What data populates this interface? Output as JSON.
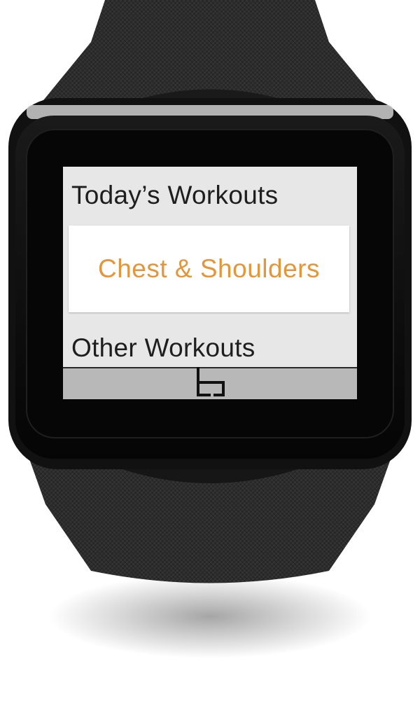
{
  "screen": {
    "sections": [
      {
        "header": "Today’s Workouts",
        "items": [
          "Chest & Shoulders"
        ]
      },
      {
        "header": "Other Workouts",
        "items": []
      }
    ]
  },
  "nav": {
    "home_icon": "home-icon"
  },
  "colors": {
    "accent": "#e3963a",
    "screen_bg": "#e7e7e7",
    "card_bg": "#ffffff",
    "nav_bar": "#b8b8b8",
    "strap": "#2d2d2d",
    "bezel": "#0c0c0c"
  }
}
